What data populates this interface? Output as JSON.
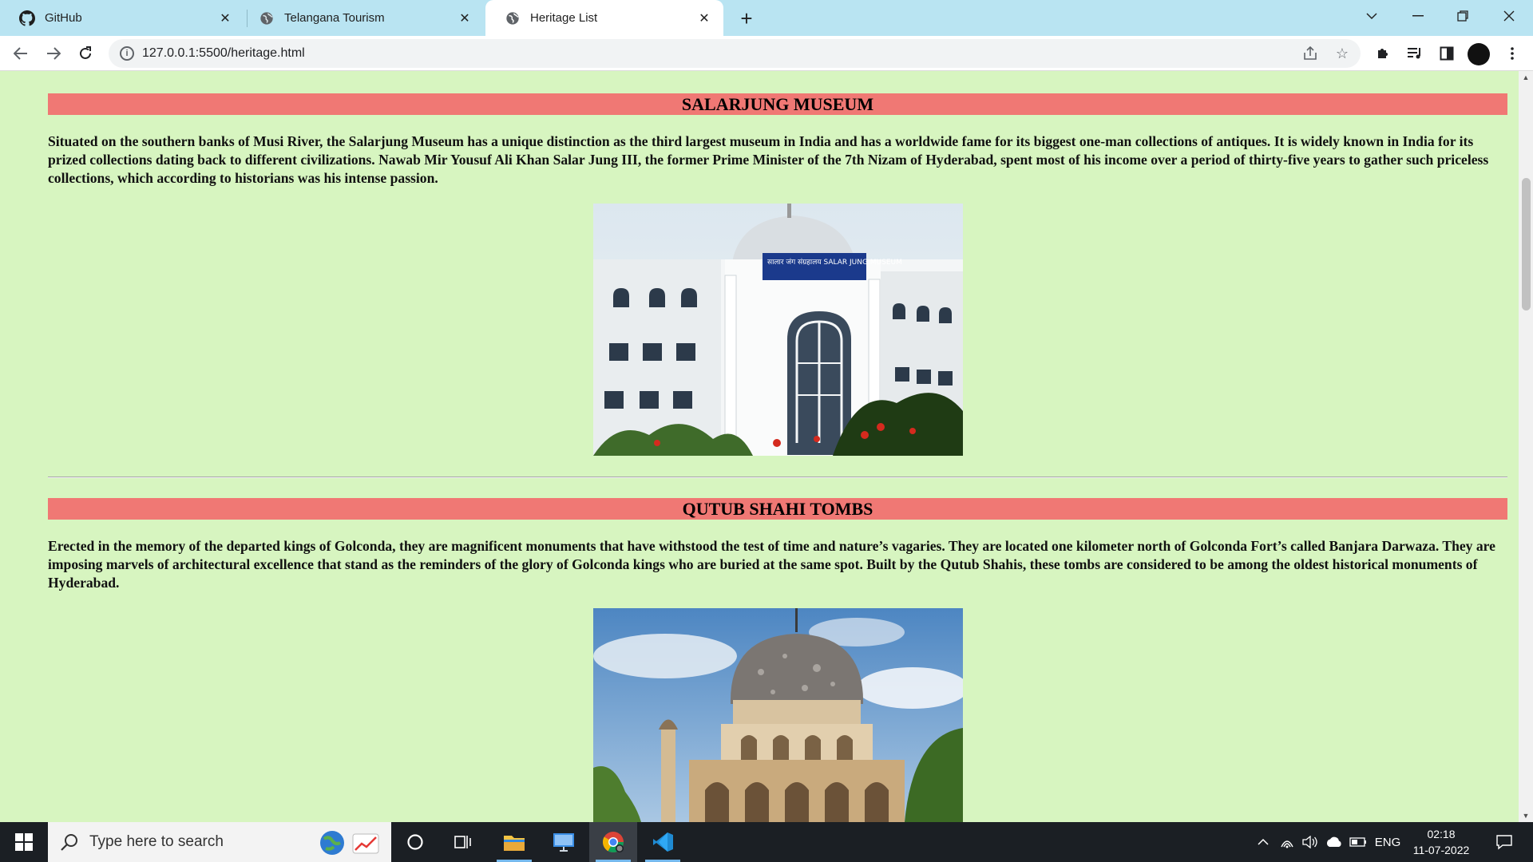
{
  "browser": {
    "tabs": [
      {
        "title": "GitHub",
        "icon": "github-icon",
        "active": false
      },
      {
        "title": "Telangana Tourism",
        "icon": "globe-icon",
        "active": false
      },
      {
        "title": "Heritage List",
        "icon": "globe-icon",
        "active": true
      }
    ],
    "url": "127.0.0.1:5500/heritage.html"
  },
  "page": {
    "sections": [
      {
        "heading": "SALARJUNG MUSEUM",
        "text": "Situated on the southern banks of Musi River, the Salarjung Museum has a unique distinction as the third largest museum in India and has a worldwide fame for its biggest one-man collections of antiques. It is widely known in India for its prized collections dating back to different civilizations. Nawab Mir Yousuf Ali Khan Salar Jung III, the former Prime Minister of the 7th Nizam of Hyderabad, spent most of his income over a period of thirty-five years to gather such priceless collections, which according to historians was his intense passion.",
        "image": "salarjung-museum-photo",
        "image_sign": "सालार जंग संग्रहालय  SALAR JUNG MUSEUM"
      },
      {
        "heading": "QUTUB SHAHI TOMBS",
        "text": "Erected in the memory of the departed kings of Golconda, they are magnificent monuments that have withstood the test of time and nature’s vagaries. They are located one kilometer north of Golconda Fort’s called Banjara Darwaza. They are imposing marvels of architectural excellence that stand as the reminders of the glory of Golconda kings who are buried at the same spot. Built by the Qutub Shahis, these tombs are considered to be among the oldest historical monuments of Hyderabad.",
        "image": "qutub-shahi-tombs-photo"
      }
    ]
  },
  "taskbar": {
    "search_placeholder": "Type here to search",
    "language": "ENG",
    "time": "02:18",
    "date": "11-07-2022"
  }
}
